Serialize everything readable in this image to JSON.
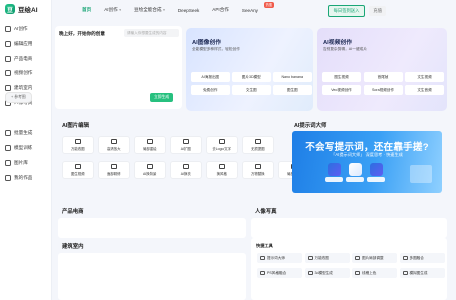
{
  "app": {
    "logo_mark": "豆",
    "logo_text": "豆绘AI"
  },
  "sidebar": {
    "items": [
      {
        "label": "AI创作",
        "icon": "ai-icon"
      },
      {
        "label": "编辑应用",
        "icon": "edit-icon"
      },
      {
        "label": "产品电商",
        "icon": "shop-icon"
      },
      {
        "label": "视频创作",
        "icon": "video-icon"
      },
      {
        "label": "建筑室内",
        "icon": "building-icon"
      },
      {
        "label": "人像写真",
        "icon": "person-icon"
      },
      {
        "label": "批量生成",
        "icon": "batch-icon"
      },
      {
        "label": "模型训练",
        "icon": "model-icon"
      },
      {
        "label": "图片库",
        "icon": "gallery-icon"
      },
      {
        "label": "我的作品",
        "icon": "folder-icon"
      }
    ]
  },
  "topnav": {
    "items": [
      {
        "label": "首页",
        "active": true,
        "dropdown": false
      },
      {
        "label": "AI创作",
        "active": false,
        "dropdown": true
      },
      {
        "label": "豆绘全能合成",
        "active": false,
        "dropdown": true
      },
      {
        "label": "DeepSeek",
        "active": false,
        "dropdown": false
      },
      {
        "label": "API合作",
        "active": false,
        "dropdown": false
      },
      {
        "label": "SeeAny",
        "active": false,
        "dropdown": false,
        "badge": "热搜"
      }
    ],
    "signin_label": "每日签到送入",
    "recharge_label": "充值"
  },
  "prompt": {
    "title": "晚上好，开始你的创意",
    "input_placeholder": "请输入你想要生成的内容",
    "ref_button": "+ 参考图",
    "generate_button": "立即生成"
  },
  "cards": {
    "image": {
      "title": "AI图像创作",
      "subtitle": "全能模型多种样式，轻松创作",
      "buttons": [
        "AI海报出图",
        "图片3D模型",
        "Nano banana",
        "免费创作",
        "文生图",
        "图生图"
      ]
    },
    "video": {
      "title": "AI视频创作",
      "subtitle": "告别复杂剪辑，AI一键成片",
      "buttons": [
        "图生视频",
        "首尾帧",
        "文生视频",
        "Veo视频创作",
        "Sora视频创作",
        "文生音频"
      ]
    }
  },
  "sections": {
    "image_edit_title": "AI图片编辑",
    "prompt_master_title": "AI提示词大师",
    "product_title": "产品电商",
    "portrait_title": "人像写真",
    "architecture_title": "建筑室内"
  },
  "tools": [
    "万能改图",
    "高清放大",
    "局部重绘",
    "AI扩图",
    "去Logo/文字",
    "无损提图",
    "",
    "图生视频",
    "面部精修",
    "AI换背景",
    "AI换衣",
    "换风格",
    "万物替换",
    "局部修改"
  ],
  "banner": {
    "title": "不会写提示词，还在靠手搓?",
    "subtitle": "「AI提示词大师」 深度思考 · 快速生成"
  },
  "quick_tools": {
    "title": "快捷工具",
    "items": [
      "提示词大师",
      "万能改图",
      "图片局部调整",
      "多图融合",
      "PS风格融合",
      "3d模型生成",
      "线稿上色",
      "模拟图生成"
    ]
  },
  "colors": {
    "accent": "#1aa676",
    "generate": "#27c07f",
    "banner_blue": "#1e7ee6"
  }
}
